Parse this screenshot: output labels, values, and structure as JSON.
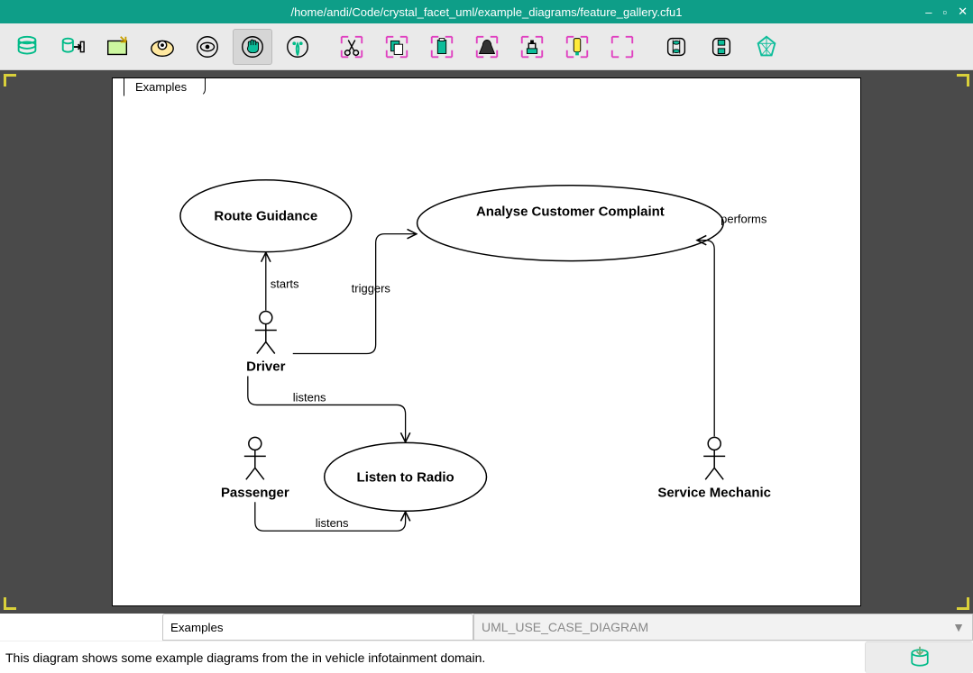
{
  "window": {
    "title": "/home/andi/Code/crystal_facet_uml/example_diagrams/feature_gallery.cfu1"
  },
  "toolbar": {
    "items": [
      {
        "name": "db-open-icon"
      },
      {
        "name": "db-export-icon"
      },
      {
        "name": "new-window-icon"
      },
      {
        "name": "folder-search-icon"
      },
      {
        "name": "view-icon"
      },
      {
        "name": "edit-hand-icon",
        "active": true
      },
      {
        "name": "new-element-icon"
      },
      {
        "name": "cut-icon"
      },
      {
        "name": "copy-icon"
      },
      {
        "name": "paste-icon"
      },
      {
        "name": "delete-icon"
      },
      {
        "name": "style-icon"
      },
      {
        "name": "highlight-icon"
      },
      {
        "name": "reset-icon"
      },
      {
        "name": "undo-icon"
      },
      {
        "name": "redo-icon"
      },
      {
        "name": "about-icon"
      }
    ]
  },
  "diagram": {
    "tab": "Examples",
    "usecases": [
      {
        "id": "route",
        "label": "Route Guidance"
      },
      {
        "id": "complaint",
        "label": "Analyse Customer Complaint"
      },
      {
        "id": "radio",
        "label": "Listen to Radio"
      }
    ],
    "actors": [
      {
        "id": "driver",
        "label": "Driver"
      },
      {
        "id": "passenger",
        "label": "Passenger"
      },
      {
        "id": "mechanic",
        "label": "Service Mechanic"
      }
    ],
    "relationships": [
      {
        "id": "starts",
        "label": "starts"
      },
      {
        "id": "triggers",
        "label": "triggers"
      },
      {
        "id": "performs",
        "label": "performs"
      },
      {
        "id": "listens1",
        "label": "listens"
      },
      {
        "id": "listens2",
        "label": "listens"
      }
    ]
  },
  "footer": {
    "name": "Examples",
    "type": "UML_USE_CASE_DIAGRAM",
    "description": "This diagram shows some example diagrams from the in vehicle infotainment domain."
  }
}
